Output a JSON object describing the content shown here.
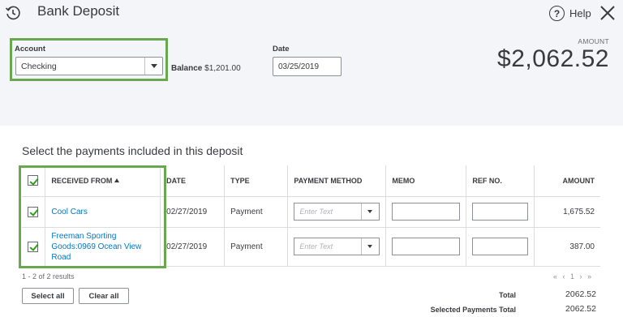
{
  "header": {
    "title": "Bank Deposit",
    "help_label": "Help",
    "icons": {
      "history": "history-clock-icon",
      "help": "help-circle-icon",
      "close": "close-icon"
    }
  },
  "account": {
    "label": "Account",
    "value": "Checking",
    "balance_label": "Balance",
    "balance_value": "$1,201.00"
  },
  "date": {
    "label": "Date",
    "value": "03/25/2019"
  },
  "amount": {
    "label": "AMOUNT",
    "value": "$2,062.52"
  },
  "payments": {
    "section_title": "Select the payments included in this deposit",
    "columns": [
      "RECEIVED FROM",
      "DATE",
      "TYPE",
      "PAYMENT METHOD",
      "MEMO",
      "REF NO.",
      "AMOUNT"
    ],
    "rows": [
      {
        "checked": true,
        "received_from": "Cool Cars",
        "date": "02/27/2019",
        "type": "Payment",
        "payment_method_placeholder": "Enter Text",
        "memo": "",
        "ref_no": "",
        "amount": "1,675.52"
      },
      {
        "checked": true,
        "received_from": "Freeman Sporting Goods:0969 Ocean View Road",
        "date": "02/27/2019",
        "type": "Payment",
        "payment_method_placeholder": "Enter Text",
        "memo": "",
        "ref_no": "",
        "amount": "387.00"
      }
    ],
    "results_text": "1 - 2 of 2 results",
    "pager_text": "« ‹ 1 › »"
  },
  "buttons": {
    "select_all": "Select all",
    "clear_all": "Clear all"
  },
  "totals": {
    "total_label": "Total",
    "total_value": "2062.52",
    "selected_label": "Selected Payments Total",
    "selected_value": "2062.52"
  },
  "colors": {
    "highlight": "#6aa84f",
    "link": "#0077c5",
    "check": "#2ca01c",
    "header_bg": "#f4f5f8"
  }
}
